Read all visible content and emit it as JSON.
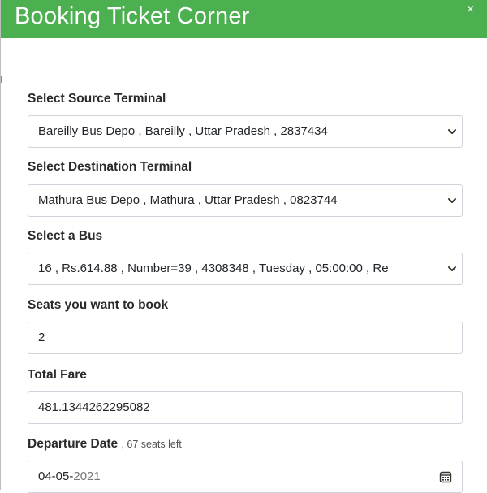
{
  "header": {
    "title": "Booking Ticket Corner",
    "close_symbol": "×"
  },
  "form": {
    "source": {
      "label": "Select Source Terminal",
      "value": "Bareilly Bus Depo , Bareilly , Uttar Pradesh , 2837434"
    },
    "destination": {
      "label": "Select Destination Terminal",
      "value": "Mathura Bus Depo , Mathura , Uttar Pradesh , 0823744"
    },
    "bus": {
      "label": "Select a Bus",
      "value": "16 , Rs.614.88 , Number=39 , 4308348 , Tuesday , 05:00:00 , Re"
    },
    "seats": {
      "label": "Seats you want to book",
      "value": "2"
    },
    "fare": {
      "label": "Total Fare",
      "value": "481.1344262295082"
    },
    "date": {
      "label": "Departure Date",
      "hint": ", 67 seats left",
      "value_day_month": "04-05-",
      "value_year": "2021"
    }
  },
  "colors": {
    "header_bg": "#4caf50",
    "header_text": "#ffffff"
  }
}
